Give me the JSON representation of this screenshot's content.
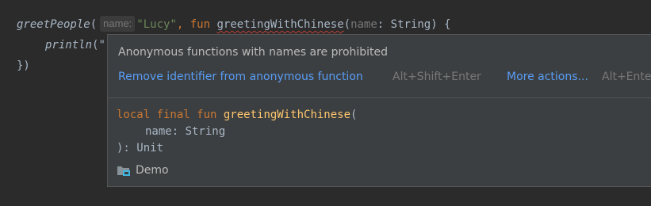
{
  "editor": {
    "line1": {
      "fn_name": "greetPeople",
      "open_paren": "(",
      "hint": "name:",
      "arg_string": "\"Lucy\"",
      "comma": ",",
      "kw_fun": "fun",
      "err_name": "greetingWithChinese",
      "paren": "(",
      "param_name": "name",
      "colon_type": ": String) {"
    },
    "line2": {
      "fn_name": "println",
      "rest": "(\""
    },
    "line3": {
      "text": "})"
    }
  },
  "popup": {
    "message": "Anonymous functions with names are prohibited",
    "fix_action": "Remove identifier from anonymous function",
    "fix_shortcut": "Alt+Shift+Enter",
    "more_action": "More actions...",
    "more_shortcut": "Alt+Enter",
    "signature": {
      "modifiers": "local final fun",
      "fn_name": "greetingWithChinese",
      "open": "(",
      "param": "name: String",
      "close": "): Unit"
    },
    "module": "Demo",
    "module_icon": "module-folder-icon"
  },
  "colors": {
    "background": "#2b2b2b",
    "popup_background": "#3c3f41",
    "keyword": "#cc7832",
    "string": "#6a8759",
    "function_decl": "#ffc66d",
    "link": "#589df6",
    "error_underline": "#bc3f3c"
  }
}
